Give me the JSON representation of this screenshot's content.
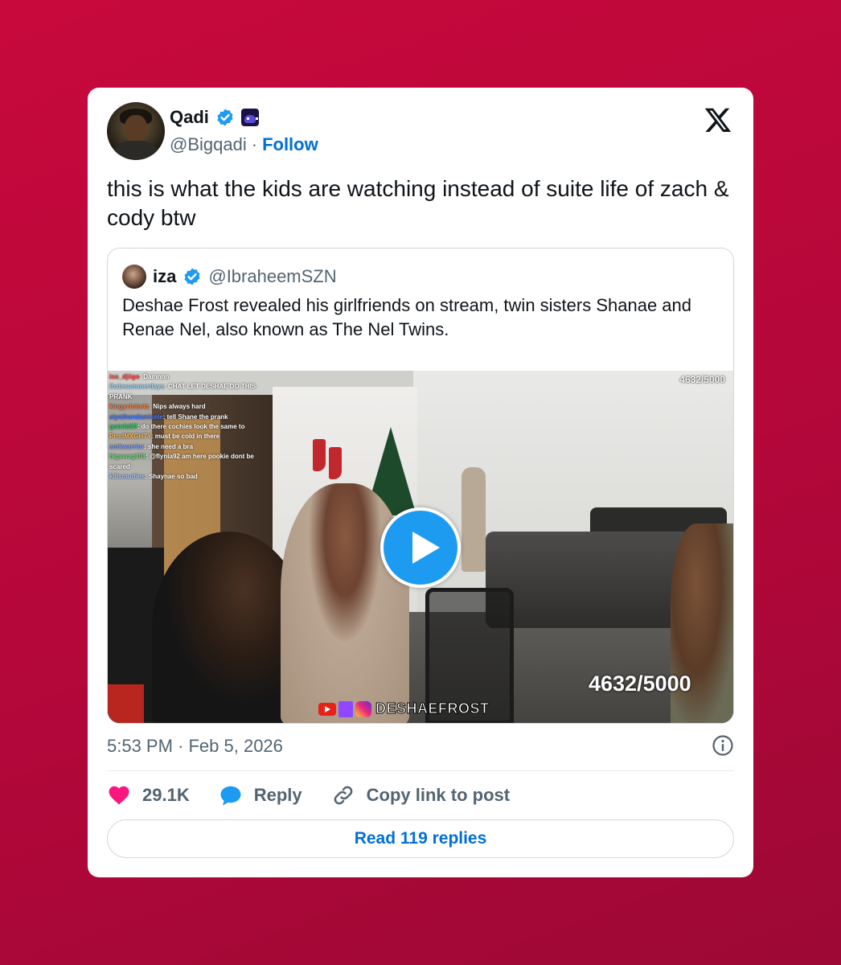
{
  "author": {
    "name": "Qadi",
    "handle": "@Bigqadi",
    "separator": "·",
    "follow_label": "Follow"
  },
  "tweet": {
    "text": "this is what the kids are watching instead of suite life of zach & cody btw",
    "timestamp": "5:53 PM · Feb 5, 2026"
  },
  "quoted": {
    "name": "iza",
    "handle": "@IbraheemSZN",
    "text": "Deshae Frost revealed his girlfriends on stream, twin sisters Shanae and Renae Nel, also known as The Nel Twins."
  },
  "video": {
    "counter_small": "4632/5000",
    "counter_large": "4632/5000",
    "watermark": "DESHAEFROST",
    "chat": [
      {
        "user": "iso_djiigo",
        "color": "#ff4d4d",
        "msg": ": Damnnn"
      },
      {
        "user": "ihatesummerdays",
        "color": "#9ad7ff",
        "msg": ": CHAT LET DESHAE DO THIS PRANK"
      },
      {
        "user": "kingyvictoria",
        "color": "#ff7a3d",
        "msg": ": Nips always hard"
      },
      {
        "user": "aiyathandamisele",
        "color": "#4d7bff",
        "msg": ": tell Shane the prank"
      },
      {
        "user": "gotnitdiff",
        "color": "#33cc66",
        "msg": ": do there cochies look the same to"
      },
      {
        "user": "ProdMXGHTY",
        "color": "#ffb84d",
        "msg": ": must be cold in there"
      },
      {
        "user": "amkwarrior",
        "color": "#7f9cff",
        "msg": ": she need a bra"
      },
      {
        "user": "bigswag101",
        "color": "#66e07a",
        "msg": ": @flynia92 am here pookie dont be scared"
      },
      {
        "user": "killsmutties",
        "color": "#a8c7ff",
        "msg": ": Shaynae so bad"
      }
    ]
  },
  "actions": {
    "likes": "29.1K",
    "reply_label": "Reply",
    "copy_label": "Copy link to post",
    "read_replies": "Read 119 replies"
  },
  "colors": {
    "background": "#b4073a",
    "accent_blue": "#1d9bf0",
    "link_blue": "#006fd6",
    "like_pink": "#f91880",
    "muted": "#536471"
  }
}
